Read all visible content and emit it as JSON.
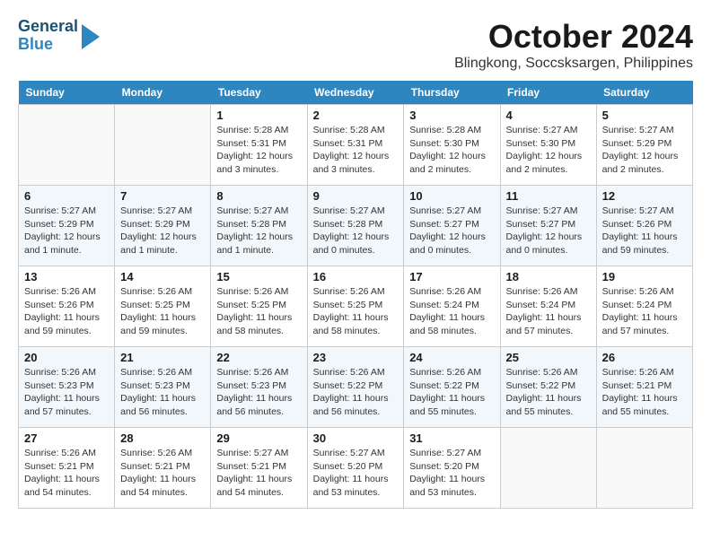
{
  "logo": {
    "line1": "General",
    "line2": "Blue"
  },
  "title": "October 2024",
  "location": "Blingkong, Soccsksargen, Philippines",
  "days_of_week": [
    "Sunday",
    "Monday",
    "Tuesday",
    "Wednesday",
    "Thursday",
    "Friday",
    "Saturday"
  ],
  "weeks": [
    [
      {
        "day": "",
        "info": ""
      },
      {
        "day": "",
        "info": ""
      },
      {
        "day": "1",
        "info": "Sunrise: 5:28 AM\nSunset: 5:31 PM\nDaylight: 12 hours\nand 3 minutes."
      },
      {
        "day": "2",
        "info": "Sunrise: 5:28 AM\nSunset: 5:31 PM\nDaylight: 12 hours\nand 3 minutes."
      },
      {
        "day": "3",
        "info": "Sunrise: 5:28 AM\nSunset: 5:30 PM\nDaylight: 12 hours\nand 2 minutes."
      },
      {
        "day": "4",
        "info": "Sunrise: 5:27 AM\nSunset: 5:30 PM\nDaylight: 12 hours\nand 2 minutes."
      },
      {
        "day": "5",
        "info": "Sunrise: 5:27 AM\nSunset: 5:29 PM\nDaylight: 12 hours\nand 2 minutes."
      }
    ],
    [
      {
        "day": "6",
        "info": "Sunrise: 5:27 AM\nSunset: 5:29 PM\nDaylight: 12 hours\nand 1 minute."
      },
      {
        "day": "7",
        "info": "Sunrise: 5:27 AM\nSunset: 5:29 PM\nDaylight: 12 hours\nand 1 minute."
      },
      {
        "day": "8",
        "info": "Sunrise: 5:27 AM\nSunset: 5:28 PM\nDaylight: 12 hours\nand 1 minute."
      },
      {
        "day": "9",
        "info": "Sunrise: 5:27 AM\nSunset: 5:28 PM\nDaylight: 12 hours\nand 0 minutes."
      },
      {
        "day": "10",
        "info": "Sunrise: 5:27 AM\nSunset: 5:27 PM\nDaylight: 12 hours\nand 0 minutes."
      },
      {
        "day": "11",
        "info": "Sunrise: 5:27 AM\nSunset: 5:27 PM\nDaylight: 12 hours\nand 0 minutes."
      },
      {
        "day": "12",
        "info": "Sunrise: 5:27 AM\nSunset: 5:26 PM\nDaylight: 11 hours\nand 59 minutes."
      }
    ],
    [
      {
        "day": "13",
        "info": "Sunrise: 5:26 AM\nSunset: 5:26 PM\nDaylight: 11 hours\nand 59 minutes."
      },
      {
        "day": "14",
        "info": "Sunrise: 5:26 AM\nSunset: 5:25 PM\nDaylight: 11 hours\nand 59 minutes."
      },
      {
        "day": "15",
        "info": "Sunrise: 5:26 AM\nSunset: 5:25 PM\nDaylight: 11 hours\nand 58 minutes."
      },
      {
        "day": "16",
        "info": "Sunrise: 5:26 AM\nSunset: 5:25 PM\nDaylight: 11 hours\nand 58 minutes."
      },
      {
        "day": "17",
        "info": "Sunrise: 5:26 AM\nSunset: 5:24 PM\nDaylight: 11 hours\nand 58 minutes."
      },
      {
        "day": "18",
        "info": "Sunrise: 5:26 AM\nSunset: 5:24 PM\nDaylight: 11 hours\nand 57 minutes."
      },
      {
        "day": "19",
        "info": "Sunrise: 5:26 AM\nSunset: 5:24 PM\nDaylight: 11 hours\nand 57 minutes."
      }
    ],
    [
      {
        "day": "20",
        "info": "Sunrise: 5:26 AM\nSunset: 5:23 PM\nDaylight: 11 hours\nand 57 minutes."
      },
      {
        "day": "21",
        "info": "Sunrise: 5:26 AM\nSunset: 5:23 PM\nDaylight: 11 hours\nand 56 minutes."
      },
      {
        "day": "22",
        "info": "Sunrise: 5:26 AM\nSunset: 5:23 PM\nDaylight: 11 hours\nand 56 minutes."
      },
      {
        "day": "23",
        "info": "Sunrise: 5:26 AM\nSunset: 5:22 PM\nDaylight: 11 hours\nand 56 minutes."
      },
      {
        "day": "24",
        "info": "Sunrise: 5:26 AM\nSunset: 5:22 PM\nDaylight: 11 hours\nand 55 minutes."
      },
      {
        "day": "25",
        "info": "Sunrise: 5:26 AM\nSunset: 5:22 PM\nDaylight: 11 hours\nand 55 minutes."
      },
      {
        "day": "26",
        "info": "Sunrise: 5:26 AM\nSunset: 5:21 PM\nDaylight: 11 hours\nand 55 minutes."
      }
    ],
    [
      {
        "day": "27",
        "info": "Sunrise: 5:26 AM\nSunset: 5:21 PM\nDaylight: 11 hours\nand 54 minutes."
      },
      {
        "day": "28",
        "info": "Sunrise: 5:26 AM\nSunset: 5:21 PM\nDaylight: 11 hours\nand 54 minutes."
      },
      {
        "day": "29",
        "info": "Sunrise: 5:27 AM\nSunset: 5:21 PM\nDaylight: 11 hours\nand 54 minutes."
      },
      {
        "day": "30",
        "info": "Sunrise: 5:27 AM\nSunset: 5:20 PM\nDaylight: 11 hours\nand 53 minutes."
      },
      {
        "day": "31",
        "info": "Sunrise: 5:27 AM\nSunset: 5:20 PM\nDaylight: 11 hours\nand 53 minutes."
      },
      {
        "day": "",
        "info": ""
      },
      {
        "day": "",
        "info": ""
      }
    ]
  ]
}
